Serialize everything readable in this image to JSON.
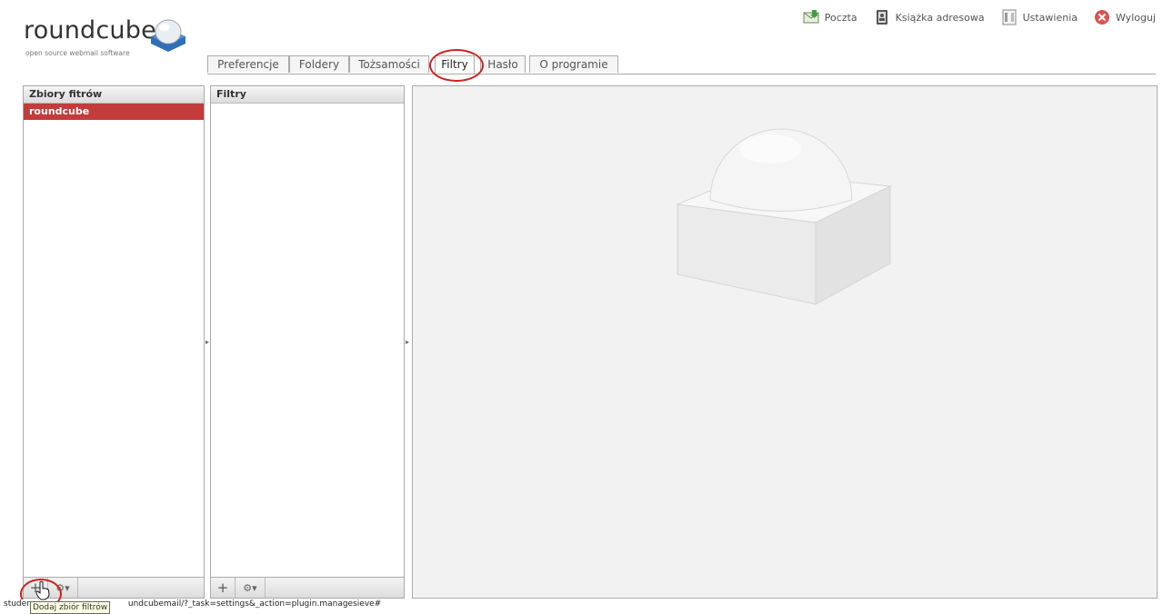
{
  "logo": {
    "wordmark": "roundcube",
    "tagline": "open source webmail software"
  },
  "topnav": [
    {
      "label": "Poczta",
      "icon": "mail-icon"
    },
    {
      "label": "Książka adresowa",
      "icon": "address-book-icon"
    },
    {
      "label": "Ustawienia",
      "icon": "settings-icon"
    },
    {
      "label": "Wyloguj",
      "icon": "logout-icon"
    }
  ],
  "tabs": [
    {
      "label": "Preferencje"
    },
    {
      "label": "Foldery"
    },
    {
      "label": "Tożsamości"
    },
    {
      "label": "Filtry",
      "active": true
    },
    {
      "label": "Hasło"
    },
    {
      "label": "O programie"
    }
  ],
  "filter_sets_panel": {
    "title": "Zbiory fitrów",
    "items": [
      {
        "label": "roundcube",
        "selected": true
      }
    ],
    "add_button": "+",
    "gear_button": "⚙▾"
  },
  "filters_panel": {
    "title": "Filtry",
    "items": [],
    "add_button": "+",
    "gear_button": "⚙▾"
  },
  "statusbar": {
    "url_prefix": "studen",
    "tooltip": "Dodaj zbiór filtrów",
    "url_suffix": "undcubemail/?_task=settings&_action=plugin.managesieve#"
  },
  "colors": {
    "selected_row": "#c33b3b",
    "highlight_oval": "#cc2222"
  }
}
